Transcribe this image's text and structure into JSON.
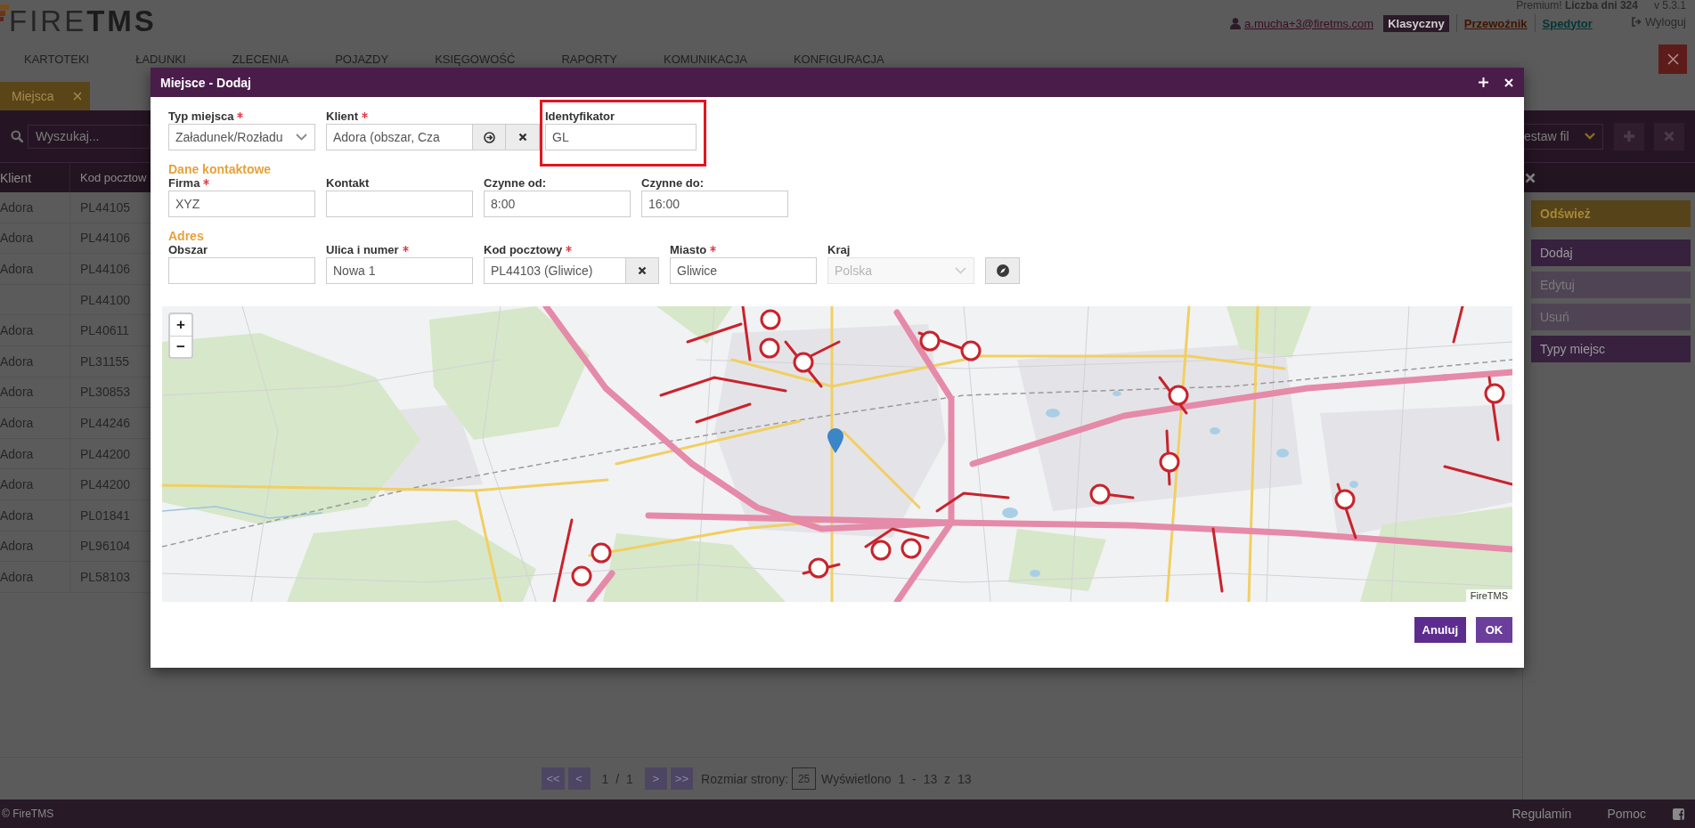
{
  "header": {
    "logo": "FIRE**TMS**",
    "plan": "Premium! **Liczba dni 324**",
    "version": "v 5.3.1",
    "user": "a.mucha+3@firetms.com",
    "modes": [
      {
        "label": "Klasyczny",
        "selected": true,
        "color": "#2b1a29"
      },
      {
        "label": "Przewoźnik",
        "selected": false,
        "color": "#401400"
      },
      {
        "label": "Spedytor",
        "selected": false,
        "color": "#043434"
      }
    ],
    "logout": "Wyloguj"
  },
  "nav": [
    "KARTOTEKI",
    "ŁADUNKI",
    "ZLECENIA",
    "POJAZDY",
    "KSIĘGOWOŚĆ",
    "RAPORTY",
    "KOMUNIKACJA",
    "KONFIGURACJA"
  ],
  "tabs": [
    {
      "label": "Miejsca",
      "selected": true
    }
  ],
  "toolbar": {
    "search_placeholder": "Wyszukaj...",
    "filter_set": "estaw fil"
  },
  "table": {
    "columns": [
      "Klient",
      "Kod pocztow"
    ],
    "rows": [
      {
        "client": "Adora",
        "postal_code": "PL44105"
      },
      {
        "client": "Adora",
        "postal_code": "PL44106"
      },
      {
        "client": "Adora",
        "postal_code": "PL44106"
      },
      {
        "postal_code": "PL44100"
      },
      {
        "client": "Adora",
        "postal_code": "PL40611"
      },
      {
        "client": "Adora",
        "postal_code": "PL31155"
      },
      {
        "client": "Adora",
        "postal_code": "PL30853"
      },
      {
        "client": "Adora",
        "postal_code": "PL44246"
      },
      {
        "client": "Adora",
        "postal_code": "PL44200"
      },
      {
        "client": "Adora",
        "postal_code": "PL44200"
      },
      {
        "client": "Adora",
        "postal_code": "PL01841"
      },
      {
        "client": "Adora",
        "postal_code": "PL96104"
      },
      {
        "client": "Adora",
        "postal_code": "PL58103"
      }
    ]
  },
  "actions": [
    {
      "label": "Odśwież",
      "kind": "accent",
      "disabled": false
    },
    {
      "label": "Dodaj",
      "kind": "normal",
      "disabled": false
    },
    {
      "label": "Edytuj",
      "kind": "normal",
      "disabled": true
    },
    {
      "label": "Usuń",
      "kind": "normal",
      "disabled": true
    },
    {
      "label": "Typy miejsc",
      "kind": "normal",
      "disabled": false
    }
  ],
  "pagination": {
    "first": "<<",
    "prev": "<",
    "page": "1 / 1",
    "next": ">",
    "last": ">>",
    "size_label": "Rozmiar strony:",
    "size": "25",
    "summary": "Wyświetlono 1 - 13 z 13"
  },
  "footer": {
    "copyright": "© FireTMS",
    "links": [
      "Regulamin",
      "Pomoc"
    ]
  },
  "dialog": {
    "title": "Miejsce - Dodaj",
    "form": [
      {
        "fields": [
          {
            "label": "Typ miejsca",
            "required": true,
            "kind": "select",
            "value": "Załadunek/Rozładu",
            "disabled": false,
            "highlighted": false
          },
          {
            "label": "Klient",
            "required": true,
            "kind": "lookup",
            "value": "Adora (obszar, Cza",
            "disabled": false,
            "highlighted": false
          },
          {
            "label": "Identyfikator",
            "required": false,
            "kind": "text",
            "value": "GL",
            "disabled": false,
            "highlighted": true
          }
        ]
      },
      {
        "section": "Dane kontaktowe",
        "fields": [
          {
            "label": "Firma",
            "required": true,
            "kind": "text",
            "value": "XYZ",
            "disabled": false,
            "highlighted": false
          },
          {
            "label": "Kontakt",
            "required": false,
            "kind": "text",
            "disabled": false,
            "highlighted": false
          },
          {
            "label": "Czynne od:",
            "required": false,
            "kind": "text",
            "value": "8:00",
            "disabled": false,
            "highlighted": false
          },
          {
            "label": "Czynne do:",
            "required": false,
            "kind": "text",
            "value": "16:00",
            "disabled": false,
            "highlighted": false
          }
        ]
      },
      {
        "section": "Adres",
        "fields": [
          {
            "label": "Obszar",
            "required": false,
            "kind": "text",
            "disabled": false,
            "highlighted": false
          },
          {
            "label": "Ulica i numer",
            "required": true,
            "kind": "text",
            "value": "Nowa 1",
            "disabled": false,
            "highlighted": false
          },
          {
            "label": "Kod pocztowy",
            "required": true,
            "kind": "clearable",
            "value": "PL44103 (Gliwice)",
            "disabled": false,
            "highlighted": false
          },
          {
            "label": "Miasto",
            "required": true,
            "kind": "text",
            "value": "Gliwice",
            "disabled": false,
            "highlighted": false
          },
          {
            "label": "Kraj",
            "required": false,
            "kind": "select",
            "value": "Polska",
            "disabled": true,
            "highlighted": false
          }
        ],
        "locate": {
          "disabled": false
        }
      }
    ],
    "map": {
      "zoom_in": "+",
      "zoom_out": "−",
      "attribution": "FireTMS"
    },
    "buttons": [
      {
        "label": "Anuluj",
        "kind": "cancel"
      },
      {
        "label": "OK",
        "kind": "ok"
      }
    ]
  }
}
